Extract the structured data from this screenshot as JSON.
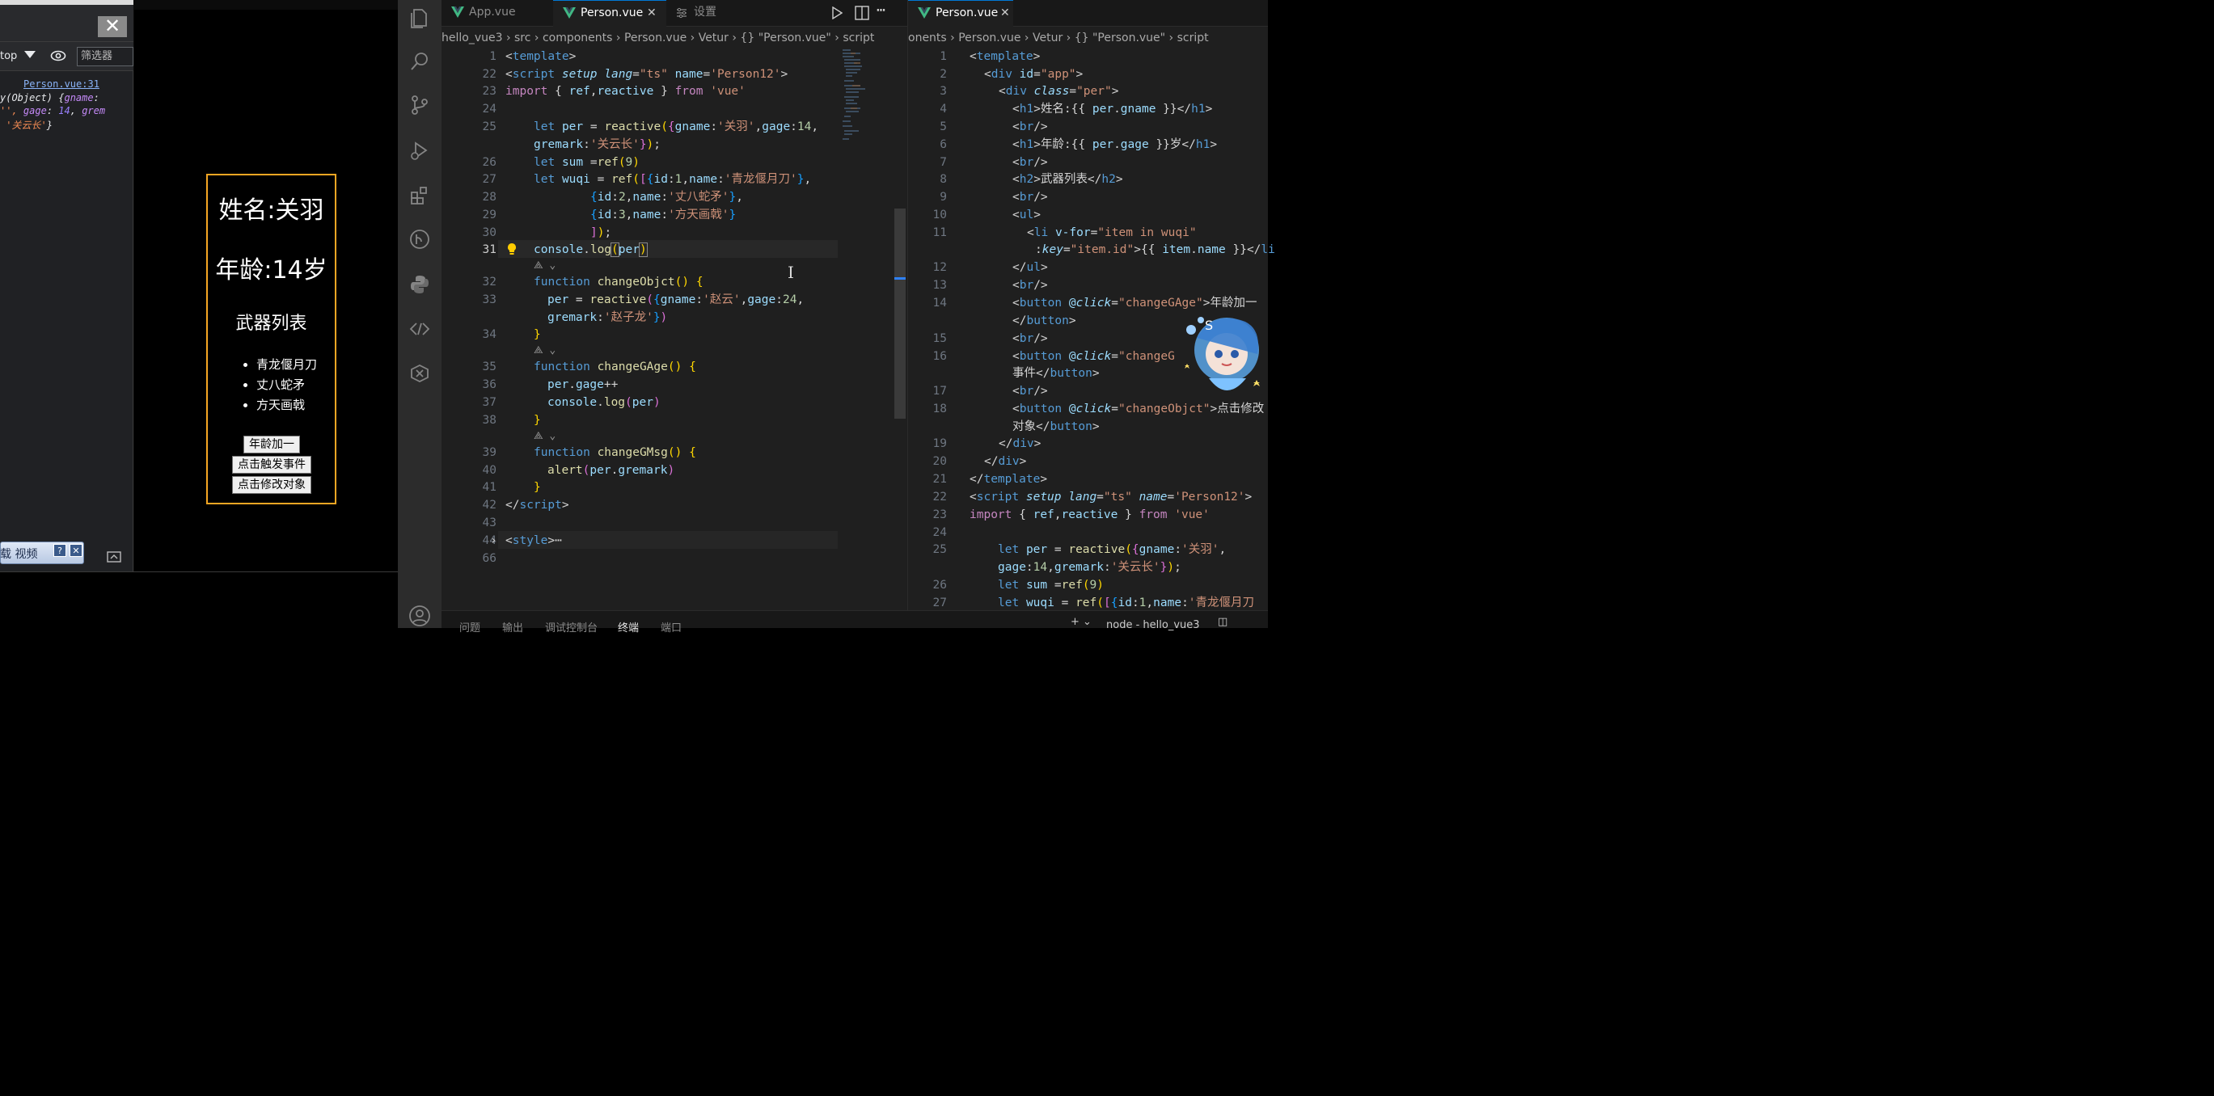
{
  "dims": "2738×1356",
  "devtools": {
    "close_glyph": "✕",
    "context": "top",
    "filter_placeholder": "筛选器",
    "log_source": "Person.vue:31",
    "log_line1_a": "y(Object) {",
    "log_line1_key": "gname",
    "log_line1_b": ":",
    "log_line2_a": "'",
    "log_line2_b": "', ",
    "log_line2_key1": "gage",
    "log_line2_num": "14",
    "log_line2_key2": "grem",
    "log_line3_str": "'关云长'",
    "log_line3_end": "}",
    "plugin_text": "载 视频",
    "plugin_help": "?",
    "plugin_close": "✕"
  },
  "app": {
    "name_line": "姓名:关羽",
    "age_line": "年龄:14岁",
    "weapons_title": "武器列表",
    "weapons": [
      "青龙偃月刀",
      "丈八蛇矛",
      "方天画戟"
    ],
    "btn_age": "年龄加一",
    "btn_event": "点击触发事件",
    "btn_change": "点击修改对象"
  },
  "vscode": {
    "tabs_left": [
      {
        "label": "App.vue"
      },
      {
        "label": "Person.vue",
        "close": "✕"
      },
      {
        "label": "设置"
      }
    ],
    "tab_right": {
      "label": "Person.vue",
      "close": "✕"
    },
    "breadcrumb_left": "hello_vue3 › src › components › Person.vue › Vetur › {} \"Person.vue\" › script",
    "breadcrumb_right": "onents › Person.vue › Vetur › {} \"Person.vue\" › script",
    "panel_tabs": [
      "问题",
      "输出",
      "调试控制台",
      "终端",
      "端口"
    ],
    "panel_right": "node - hello_vue3",
    "left_line_numbers": [
      "1",
      "22",
      "23",
      "24",
      "25",
      "",
      "26",
      "27",
      "28",
      "29",
      "30",
      "31",
      "",
      "32",
      "33",
      "",
      "34",
      "",
      "35",
      "36",
      "37",
      "38",
      "",
      "39",
      "40",
      "41",
      "42",
      "43",
      "44",
      "66"
    ],
    "right_line_numbers": [
      "1",
      "2",
      "3",
      "4",
      "5",
      "6",
      "7",
      "8",
      "9",
      "10",
      "11",
      "",
      "12",
      "13",
      "14",
      "",
      "15",
      "16",
      "",
      "17",
      "18",
      "",
      "19",
      "20",
      "21",
      "22",
      "23",
      "24",
      "25",
      "",
      "26",
      "27"
    ]
  }
}
